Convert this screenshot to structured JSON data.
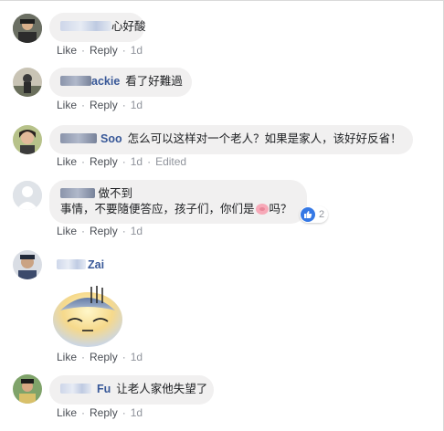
{
  "comments": [
    {
      "name": "心好酸",
      "name_visible": "",
      "text": "",
      "actions": {
        "like": "Like",
        "reply": "Reply",
        "time": "1d"
      }
    },
    {
      "name_visible": "ackie",
      "text": "看了好難過",
      "actions": {
        "like": "Like",
        "reply": "Reply",
        "time": "1d"
      }
    },
    {
      "name_visible": "Soo",
      "text": "怎么可以这样对一个老人？如果是家人，该好好反省！",
      "actions": {
        "like": "Like",
        "reply": "Reply",
        "time": "1d",
        "edited": "Edited"
      }
    },
    {
      "name_visible": "",
      "text_line1": "做不到",
      "text_line2_a": "事情，不要隨便答应，孩子们，你们是",
      "text_line2_b": "吗？",
      "reactions": "2",
      "actions": {
        "like": "Like",
        "reply": "Reply",
        "time": "1d"
      }
    },
    {
      "name_visible": "Zai",
      "text": "",
      "actions": {
        "like": "Like",
        "reply": "Reply",
        "time": "1d"
      }
    },
    {
      "name_visible": "Fu",
      "text": "让老人家他失望了",
      "actions": {
        "like": "Like",
        "reply": "Reply",
        "time": "1d"
      }
    }
  ],
  "colors": {
    "name": "#385898",
    "bubble": "#f1f0f0",
    "meta": "#90949c",
    "like_blue": "#3578e5"
  },
  "icons": [
    "user-avatar",
    "like-icon",
    "pig-emoji-icon",
    "sad-sticker"
  ]
}
